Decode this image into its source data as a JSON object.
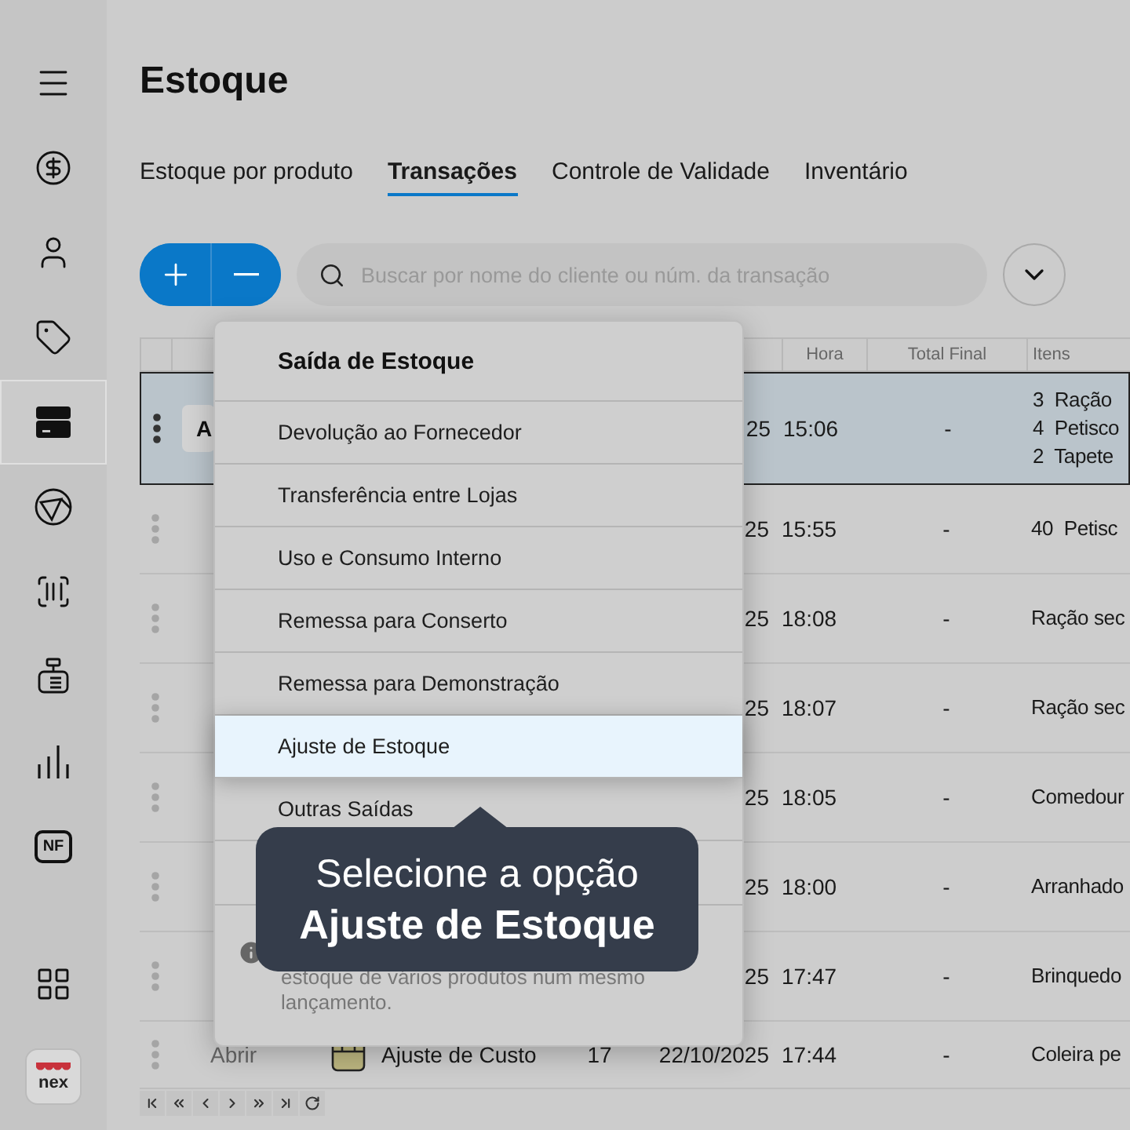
{
  "sidebar": {
    "items": [
      {
        "selected": false
      },
      {
        "selected": false
      },
      {
        "selected": false
      },
      {
        "selected": false
      },
      {
        "selected": true
      },
      {
        "selected": false
      },
      {
        "selected": false
      },
      {
        "selected": false
      },
      {
        "selected": false
      },
      {
        "label": "NF",
        "selected": false
      }
    ],
    "logo": "nex"
  },
  "title": "Estoque",
  "tabs": [
    {
      "label": "Estoque por produto",
      "selected": false
    },
    {
      "label": "Transações",
      "selected": true
    },
    {
      "label": "Controle de Validade",
      "selected": false
    },
    {
      "label": "Inventário",
      "selected": false
    }
  ],
  "search": {
    "placeholder": "Buscar por nome do cliente ou núm. da transação"
  },
  "table": {
    "columns": [
      "Hora",
      "Total Final",
      "Itens"
    ],
    "rows": [
      {
        "selected": true,
        "action": "A",
        "date": "25",
        "time": "15:06",
        "total": "-",
        "items": [
          "3  Ração",
          "4  Petisco",
          "2  Tapete"
        ]
      },
      {
        "selected": false,
        "date": "25",
        "time": "15:55",
        "total": "-",
        "items": [
          "40  Petisc"
        ]
      },
      {
        "selected": false,
        "date": "25",
        "time": "18:08",
        "total": "-",
        "items": [
          "Ração sec"
        ]
      },
      {
        "selected": false,
        "date": "25",
        "time": "18:07",
        "total": "-",
        "items": [
          "Ração sec"
        ]
      },
      {
        "selected": false,
        "date": "25",
        "time": "18:05",
        "total": "-",
        "items": [
          "Comedour"
        ]
      },
      {
        "selected": false,
        "date": "25",
        "time": "18:00",
        "total": "-",
        "items": [
          "Arranhado"
        ]
      },
      {
        "selected": false,
        "date": "25",
        "time": "17:47",
        "total": "-",
        "items": [
          "Brinquedo"
        ]
      },
      {
        "selected": false,
        "action": "Abrir",
        "type": "Ajuste de Custo",
        "number": "17",
        "date": "22/10/2025",
        "time": "17:44",
        "total": "-",
        "items": [
          "Coleira pe"
        ]
      }
    ]
  },
  "menu": {
    "title": "Saída de Estoque",
    "items": [
      {
        "label": "Devolução ao Fornecedor",
        "selected": false
      },
      {
        "label": "Transferência entre Lojas",
        "selected": false
      },
      {
        "label": "Uso e Consumo Interno",
        "selected": false
      },
      {
        "label": "Remessa para Conserto",
        "selected": false
      },
      {
        "label": "Remessa para Demonstração",
        "selected": false
      },
      {
        "label": "Ajuste de Estoque",
        "selected": true
      },
      {
        "label": "Outras Saídas",
        "selected": false
      }
    ],
    "info": "estoque de vários produtos num mesmo lançamento."
  },
  "tooltip": {
    "line_1": "Selecione a opção",
    "line_2": "Ajuste de Estoque"
  }
}
